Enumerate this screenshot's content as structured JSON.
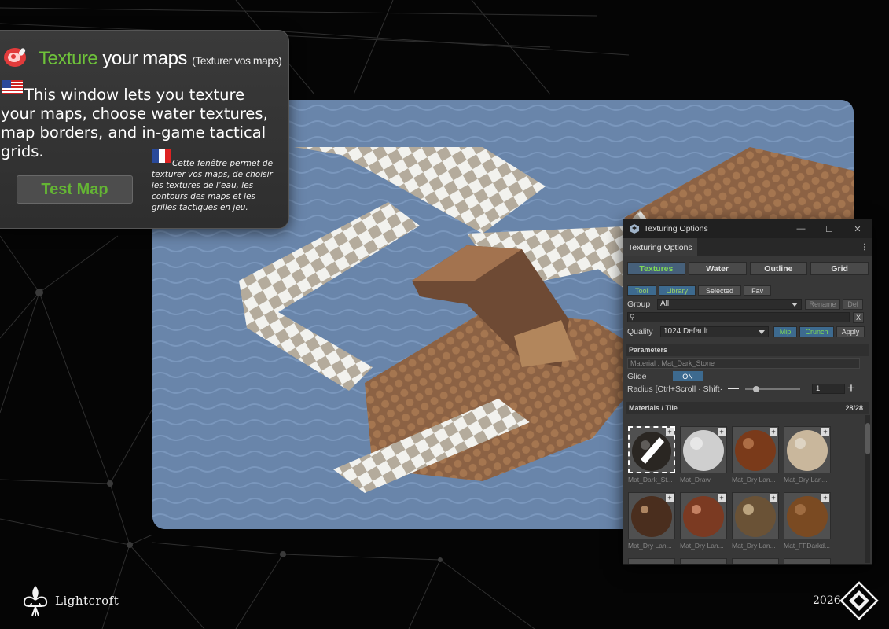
{
  "info_card": {
    "title_accent": "Texture",
    "title_main": " your maps ",
    "title_sub": "(Texturer vos maps)",
    "english_text": "This window lets you texture your maps, choose water textures, map borders, and in-game tactical grids.",
    "french_text": "Cette fenêtre permet de texturer vos maps, de choisir les textures de l’eau, les contours des maps et les grilles tactiques en jeu.",
    "test_button": "Test Map"
  },
  "window": {
    "title": "Texturing Options",
    "tab": "Texturing Options",
    "main_tabs": [
      "Textures",
      "Water",
      "Outline",
      "Grid"
    ],
    "sub_tabs": [
      "Tool",
      "Library",
      "Selected",
      "Fav"
    ],
    "group_label": "Group",
    "group_value": "All",
    "rename_btn": "Rename",
    "del_btn": "Del",
    "search_clear": "X",
    "quality_label": "Quality",
    "quality_value": "1024 Default",
    "mip_btn": "Mip",
    "crunch_btn": "Crunch",
    "apply_btn": "Apply",
    "parameters_header": "Parameters",
    "material_field": "Material : Mat_Dark_Stone",
    "glide_label": "Glide",
    "glide_value": "ON",
    "radius_label": "Radius  [Ctrl+Scroll · Shift·",
    "radius_value": "1",
    "materials_header": "Materials / Tile",
    "materials_count": "28/28",
    "materials": [
      {
        "name": "Mat_Dark_St...",
        "color": "#2a2622"
      },
      {
        "name": "Mat_Draw",
        "color": "#cfcfcf"
      },
      {
        "name": "Mat_Dry Lan...",
        "color": "#7a3a1a"
      },
      {
        "name": "Mat_Dry Lan...",
        "color": "#c9b79c"
      },
      {
        "name": "Mat_Dry Lan...",
        "color": "#4a2e1e"
      },
      {
        "name": "Mat_Dry Lan...",
        "color": "#7b3a22"
      },
      {
        "name": "Mat_Dry Lan...",
        "color": "#6a5236"
      },
      {
        "name": "Mat_FFDarkd...",
        "color": "#7a4a22"
      }
    ]
  },
  "footer": {
    "brand": "Lightcroft",
    "year": "2026"
  },
  "colors": {
    "accent_green": "#6ec23a",
    "active_blue": "#3d6a8f"
  }
}
